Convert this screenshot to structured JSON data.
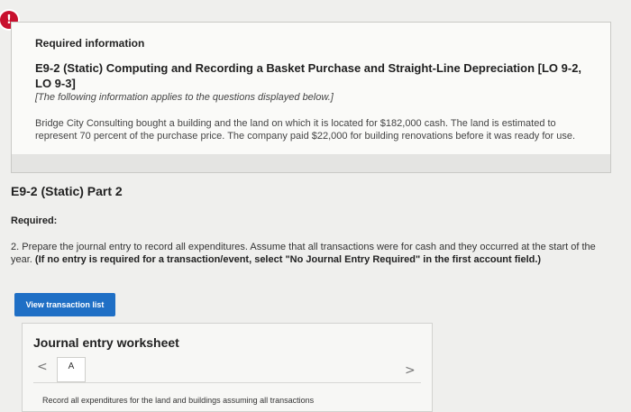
{
  "alert": {
    "icon": "exclamation-icon",
    "glyph": "!",
    "color": "#c8102e"
  },
  "info": {
    "heading": "Required information",
    "title": "E9-2 (Static) Computing and Recording a Basket Purchase and Straight-Line Depreciation [LO 9-2, LO 9-3]",
    "note": "[The following information applies to the questions displayed below.]",
    "body": "Bridge City Consulting bought a building and the land on which it is located for $182,000 cash. The land is estimated to represent 70 percent of the purchase price. The company paid $22,000 for building renovations before it was ready for use."
  },
  "part": {
    "title": "E9-2 (Static) Part 2"
  },
  "required": {
    "label": "Required:",
    "instruction": "2. Prepare the journal entry to record all expenditures. Assume that all transactions were for cash and they occurred at the start of the year.",
    "bold_note": "(If no entry is required for a transaction/event, select \"No Journal Entry Required\" in the first account field.)"
  },
  "buttons": {
    "view_transactions": "View transaction list",
    "accent": "#1f6fc5"
  },
  "worksheet": {
    "title": "Journal entry worksheet",
    "prev_glyph": "<",
    "next_glyph": ">",
    "tab_label": "A",
    "instruction_text": "Record all expenditures for the land and buildings assuming all transactions"
  }
}
